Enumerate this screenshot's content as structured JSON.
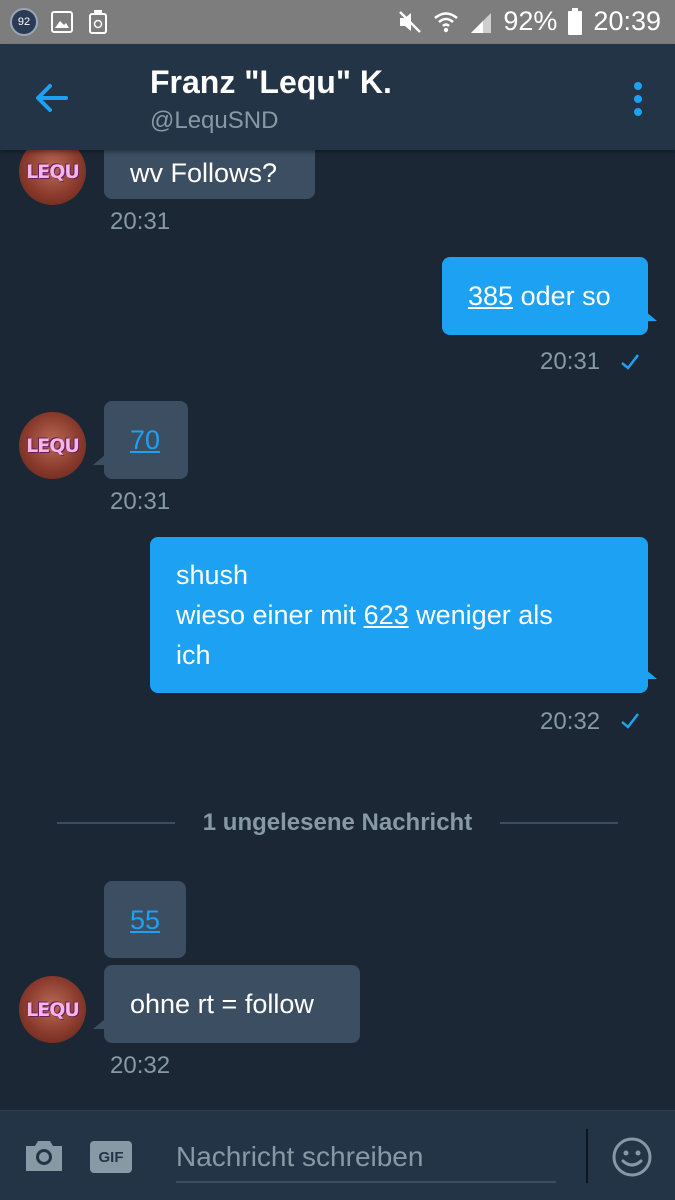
{
  "statusbar": {
    "badge": "92",
    "battery": "92%",
    "time": "20:39"
  },
  "header": {
    "name": "Franz \"Lequ\" K.",
    "handle": "@LequSND"
  },
  "avatar_label": "LEQU",
  "messages": [
    {
      "dir": "in",
      "text": "wv Follows?",
      "time": "20:31"
    },
    {
      "dir": "out",
      "link": "385",
      "text_after": " oder so",
      "time": "20:31"
    },
    {
      "dir": "in",
      "link": "70",
      "time": "20:31"
    },
    {
      "dir": "out",
      "line1": "shush",
      "line2_before": "wieso einer mit ",
      "link": "623",
      "line2_after": " weniger als",
      "line3": "ich",
      "time": "20:32"
    },
    {
      "dir": "in",
      "link": "55"
    },
    {
      "dir": "in",
      "text": "ohne rt = follow",
      "time": "20:32"
    }
  ],
  "divider_label": "1 ungelesene Nachricht",
  "composer": {
    "gif_label": "GIF",
    "placeholder": "Nachricht schreiben"
  },
  "colors": {
    "background": "#1b2735",
    "header": "#243447",
    "bubble_in": "#3c4e61",
    "bubble_out": "#1da1f2",
    "muted": "#8899a6",
    "accent": "#1da1f2"
  }
}
